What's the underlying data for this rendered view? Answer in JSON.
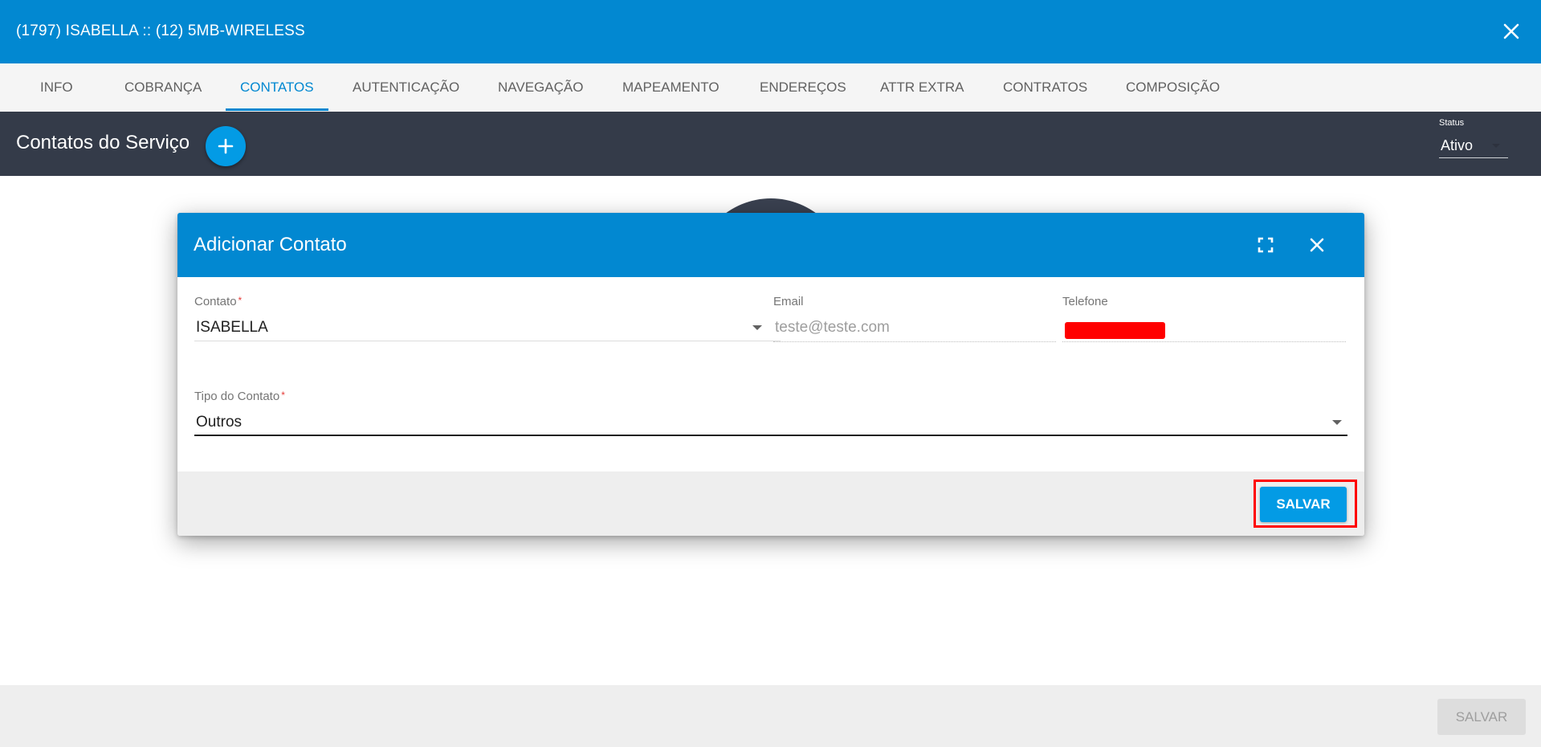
{
  "window": {
    "title": "(1797) ISABELLA :: (12) 5MB-WIRELESS",
    "close_icon": "close-icon"
  },
  "tabs": [
    {
      "label": "INFO",
      "active": false
    },
    {
      "label": "COBRANÇA",
      "active": false
    },
    {
      "label": "CONTATOS",
      "active": true
    },
    {
      "label": "AUTENTICAÇÃO",
      "active": false
    },
    {
      "label": "NAVEGAÇÃO",
      "active": false
    },
    {
      "label": "MAPEAMENTO",
      "active": false
    },
    {
      "label": "ENDEREÇOS",
      "active": false
    },
    {
      "label": "ATTR EXTRA",
      "active": false
    },
    {
      "label": "CONTRATOS",
      "active": false
    },
    {
      "label": "COMPOSIÇÃO",
      "active": false
    }
  ],
  "section": {
    "title": "Contatos do Serviço",
    "add_icon": "plus-icon",
    "status_label": "Status",
    "status_value": "Ativo"
  },
  "dialog": {
    "title": "Adicionar Contato",
    "expand_icon": "fullscreen-icon",
    "close_icon": "close-icon",
    "fields": {
      "contato": {
        "label": "Contato",
        "required_mark": "*",
        "value": "ISABELLA"
      },
      "email": {
        "label": "Email",
        "placeholder": "teste@teste.com"
      },
      "telefone": {
        "label": "Telefone"
      },
      "tipo": {
        "label": "Tipo do Contato",
        "required_mark": "*",
        "value": "Outros"
      }
    },
    "save_label": "SALVAR"
  },
  "footer": {
    "save_label": "SALVAR"
  },
  "colors": {
    "primary": "#0288d1",
    "accent": "#039be5",
    "dark_bar": "#343b49",
    "highlight": "#ff0000"
  }
}
